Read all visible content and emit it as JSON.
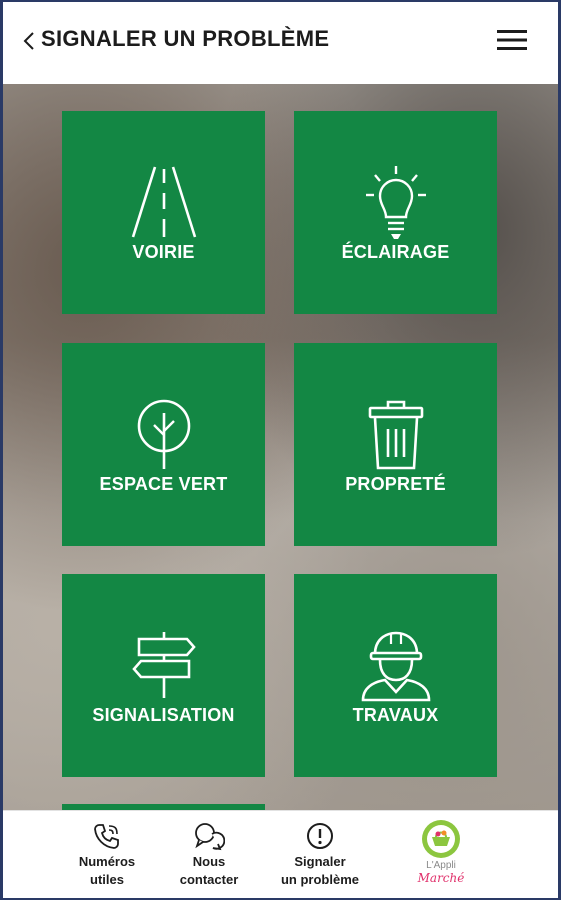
{
  "header": {
    "title": "SIGNALER UN PROBLÈME",
    "back_icon": "chevron-left-icon",
    "menu_icon": "hamburger-menu-icon"
  },
  "tiles": [
    {
      "label": "VOIRIE",
      "icon": "road-icon"
    },
    {
      "label": "ÉCLAIRAGE",
      "icon": "light-bulb-icon"
    },
    {
      "label": "ESPACE VERT",
      "icon": "tree-icon"
    },
    {
      "label": "PROPRETÉ",
      "icon": "trash-bin-icon"
    },
    {
      "label": "SIGNALISATION",
      "icon": "signpost-icon"
    },
    {
      "label": "TRAVAUX",
      "icon": "worker-helmet-icon"
    }
  ],
  "bottom_nav": {
    "items": [
      {
        "line1": "Numéros",
        "line2": "utiles",
        "icon": "phone-icon"
      },
      {
        "line1": "Nous",
        "line2": "contacter",
        "icon": "chat-bubbles-icon"
      },
      {
        "line1": "Signaler",
        "line2": "un problème",
        "icon": "alert-circle-icon"
      }
    ],
    "logo": {
      "line1": "L'Appli",
      "line2": "Marché",
      "icon": "appli-marche-logo-icon"
    }
  },
  "colors": {
    "tile_green": "#138744",
    "header_bg": "#ffffff",
    "title_text": "#1c1c1c",
    "logo_green": "#8cc63f",
    "logo_pink": "#e0316b"
  }
}
